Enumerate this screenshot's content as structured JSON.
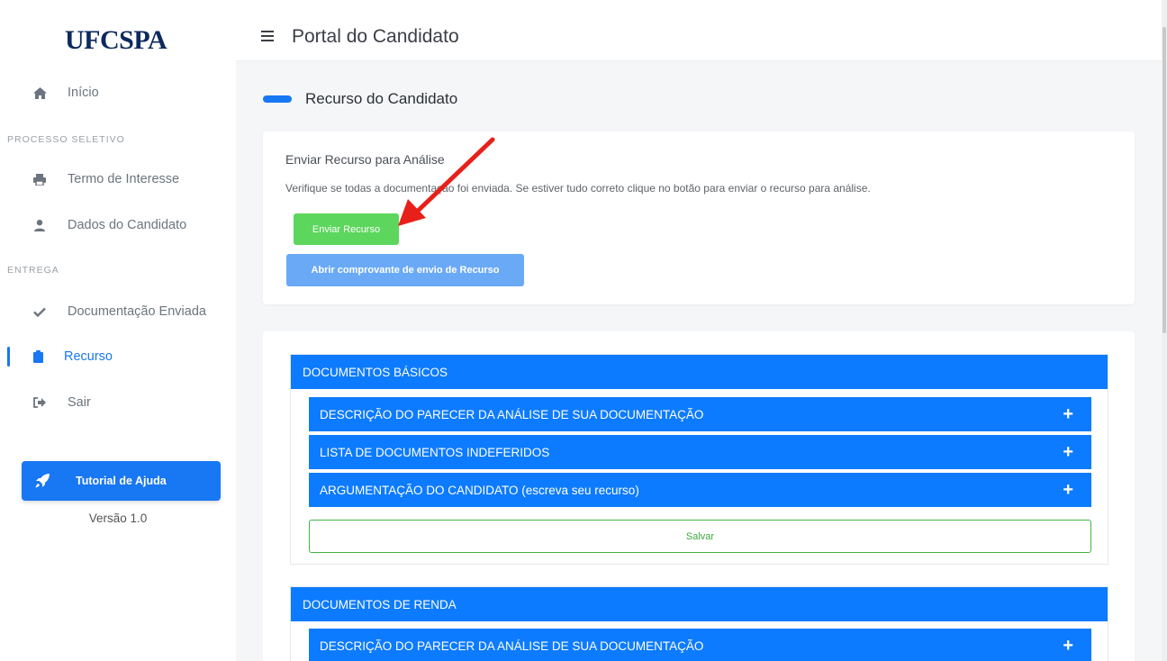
{
  "sidebar": {
    "logo": "UFCSPA",
    "items": [
      {
        "label": "Início",
        "icon": "home-icon"
      },
      {
        "label": "Termo de Interesse",
        "icon": "printer-icon"
      },
      {
        "label": "Dados do Candidato",
        "icon": "user-icon"
      },
      {
        "label": "Documentação Enviada",
        "icon": "check-icon"
      },
      {
        "label": "Recurso",
        "icon": "clipboard-icon"
      },
      {
        "label": "Sair",
        "icon": "sign-out-icon"
      }
    ],
    "section_processo": "PROCESSO SELETIVO",
    "section_entrega": "ENTREGA",
    "help_label": "Tutorial de Ajuda",
    "version": "Versão 1.0"
  },
  "header": {
    "title": "Portal do Candidato"
  },
  "page": {
    "title": "Recurso do Candidato"
  },
  "send_card": {
    "title": "Enviar Recurso para Análise",
    "text": "Verifique se todas a documentação foi enviada. Se estiver tudo correto clique no botão para enviar o recurso para análise.",
    "send_button": "Enviar Recurso",
    "receipt_button": "Abrir comprovante de envio de Recurso"
  },
  "blocks": [
    {
      "title": "DOCUMENTOS BÁSICOS",
      "rows": [
        "DESCRIÇÃO DO PARECER DA ANÁLISE DE SUA DOCUMENTAÇÃO",
        "LISTA DE DOCUMENTOS INDEFERIDOS",
        "ARGUMENTAÇÃO DO CANDIDATO (escreva seu recurso)"
      ],
      "save_label": "Salvar"
    },
    {
      "title": "DOCUMENTOS DE RENDA",
      "rows": [
        "DESCRIÇÃO DO PARECER DA ANÁLISE DE SUA DOCUMENTAÇÃO"
      ]
    }
  ],
  "colors": {
    "primary": "#0d7bff",
    "success": "#5cd65c",
    "annotation_arrow": "#e8201a"
  }
}
